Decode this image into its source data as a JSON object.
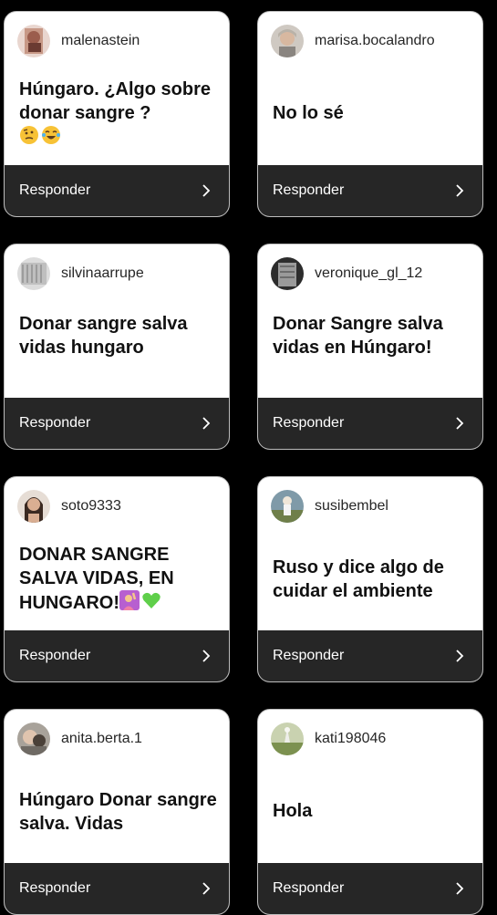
{
  "cards": [
    {
      "username": "malenastein",
      "answer": "Húngaro. ¿Algo sobre donar sangre ?",
      "emojis": [
        "thinking-face",
        "tears-of-joy"
      ],
      "reply": "Responder"
    },
    {
      "username": "marisa.bocalandro",
      "answer": "No lo sé",
      "emojis": [],
      "reply": "Responder"
    },
    {
      "username": "silvinaarrupe",
      "answer": "Donar sangre salva vidas hungaro",
      "emojis": [],
      "reply": "Responder"
    },
    {
      "username": "veronique_gl_12",
      "answer": "Donar Sangre salva vidas en  Húngaro!",
      "emojis": [],
      "reply": "Responder"
    },
    {
      "username": "soto9333",
      "answer": "DONAR SANGRE SALVA VIDAS, EN HUNGARO!",
      "emojis": [
        "person-raising-hand",
        "green-heart"
      ],
      "reply": "Responder"
    },
    {
      "username": "susibembel",
      "answer": "Ruso y dice algo de cuidar el ambiente",
      "emojis": [],
      "reply": "Responder"
    },
    {
      "username": "anita.berta.1",
      "answer": "Húngaro Donar sangre salva. Vidas",
      "emojis": [],
      "reply": "Responder"
    },
    {
      "username": "kati198046",
      "answer": "Hola",
      "emojis": [],
      "reply": "Responder"
    }
  ],
  "colors": {
    "background": "#000000",
    "card": "#ffffff",
    "reply_bar": "#262626",
    "reply_text": "#ffffff"
  },
  "icons": {
    "reply_chevron": "chevron-right-icon"
  }
}
